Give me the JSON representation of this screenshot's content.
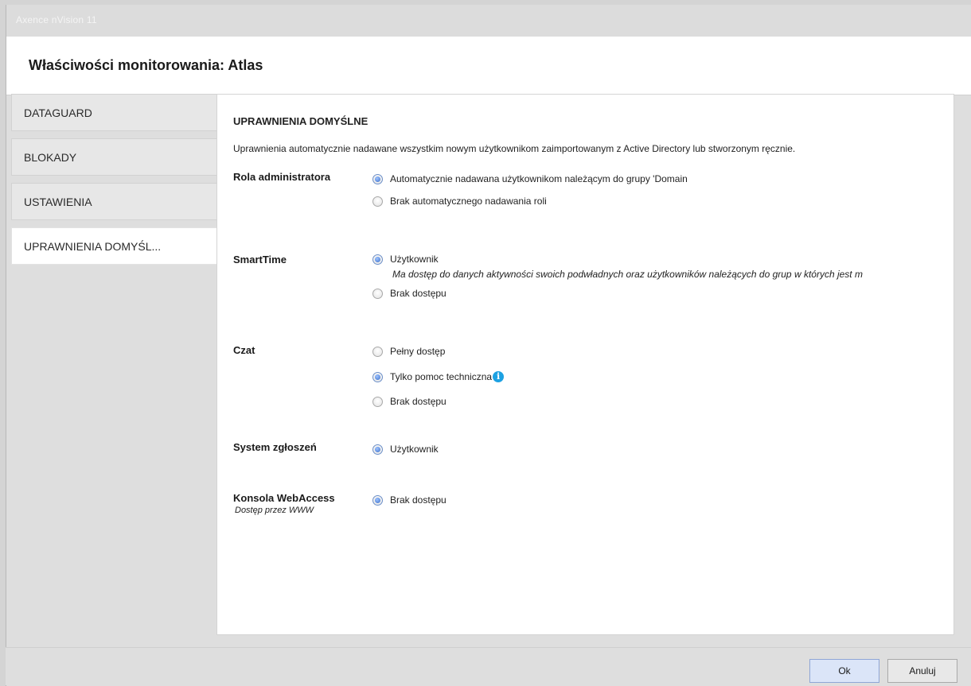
{
  "window": {
    "app_title": "Axence nVision 11"
  },
  "dialog": {
    "title": "Właściwości monitorowania: Atlas"
  },
  "sidebar": {
    "items": [
      {
        "label": "DATAGUARD",
        "active": false
      },
      {
        "label": "BLOKADY",
        "active": false
      },
      {
        "label": "USTAWIENIA",
        "active": false
      },
      {
        "label": "UPRAWNIENIA DOMYŚL...",
        "active": true
      }
    ]
  },
  "content": {
    "section_title": "UPRAWNIENIA DOMYŚLNE",
    "description": "Uprawnienia automatycznie nadawane wszystkim nowym użytkownikom zaimportowanym z Active Directory lub stworzonym ręcznie.",
    "groups": [
      {
        "label": "Rola administratora",
        "options": [
          {
            "label": "Automatycznie nadawana użytkownikom należącym do grupy 'Domain",
            "checked": true
          },
          {
            "label": "Brak automatycznego nadawania roli",
            "checked": false
          }
        ]
      },
      {
        "label": "SmartTime",
        "options": [
          {
            "label": "Użytkownik",
            "checked": true,
            "description": "Ma dostęp do danych aktywności swoich podwładnych oraz użytkowników należących do grup w których jest m"
          },
          {
            "label": "Brak dostępu",
            "checked": false
          }
        ]
      },
      {
        "label": "Czat",
        "options": [
          {
            "label": "Pełny dostęp",
            "checked": false
          },
          {
            "label": "Tylko pomoc techniczna",
            "checked": true,
            "icon": "info-icon"
          },
          {
            "label": "Brak dostępu",
            "checked": false
          }
        ]
      },
      {
        "label": "System zgłoszeń",
        "options": [
          {
            "label": "Użytkownik",
            "checked": true
          }
        ]
      },
      {
        "label": "Konsola WebAccess",
        "sublabel": "Dostęp przez WWW",
        "options": [
          {
            "label": "Brak dostępu",
            "checked": true
          }
        ]
      }
    ]
  },
  "footer": {
    "ok_label": "Ok",
    "cancel_label": "Anuluj"
  },
  "colors": {
    "accent": "#1da1e2",
    "ok_button_bg": "#dbe5f8"
  }
}
